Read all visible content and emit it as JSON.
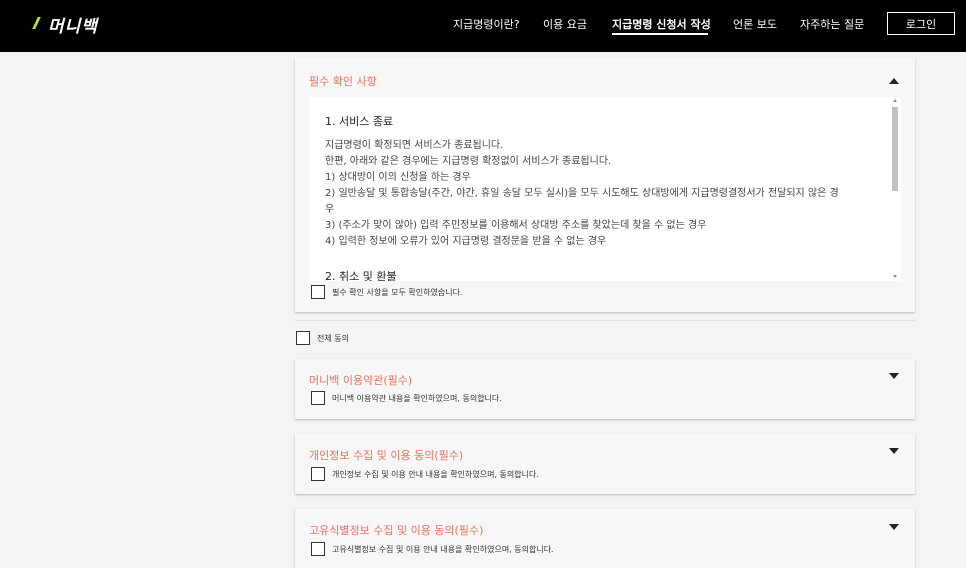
{
  "header": {
    "logo_text": "머니백",
    "nav": [
      {
        "label": "지급명령이란?"
      },
      {
        "label": "이용 요금"
      },
      {
        "label": "지급명령 신청서 작성"
      },
      {
        "label": "언론 보도"
      },
      {
        "label": "자주하는 질문"
      }
    ],
    "login_label": "로그인"
  },
  "required_panel": {
    "title": "필수 확인 사항",
    "section1_title": "1. 서비스 종료",
    "lines": [
      "지급명령이 확정되면 서비스가 종료됩니다.",
      "한편, 아래와 같은 경우에는 지급명령 확정없이 서비스가 종료됩니다.",
      "1) 상대방이 이의 신청을 하는 경우",
      "2) 일반송달 및 통합송달(주간, 야간, 휴일 송달 모두 실시)을 모두 시도해도 상대방에게 지급명령결정서가 전달되지 않은 경",
      "우",
      "3) (주소가 맞이 않아) 입력 주민정보를 이용해서 상대방 주소를 찾았는데 찾을 수 없는 경우",
      "4) 입력한 정보에 오류가 있어 지급명령 결정문을 받을 수 없는 경우"
    ],
    "section2_title": "2. 취소 및 환불",
    "confirm_label": "필수 확인 사항을 모두 확인하였습니다."
  },
  "agree_all_label": "전체 동의",
  "agreements": [
    {
      "title": "머니백 이용약관(필수)",
      "check_label": "머니백 이용약관 내용을 확인하였으며, 동의합니다."
    },
    {
      "title": "개인정보 수집 및 이용 동의(필수)",
      "check_label": "개인정보 수집 및 이용 안내 내용을 확인하였으며, 동의합니다."
    },
    {
      "title": "고유식별정보 수집 및 이용 동의(필수)",
      "check_label": "고유식별정보 수집 및 이용 안내 내용을 확인하였으며, 동의합니다."
    }
  ],
  "colors": {
    "accent": "#e8735d",
    "logo_mark": "#b9e334",
    "header_bg": "#000000"
  }
}
